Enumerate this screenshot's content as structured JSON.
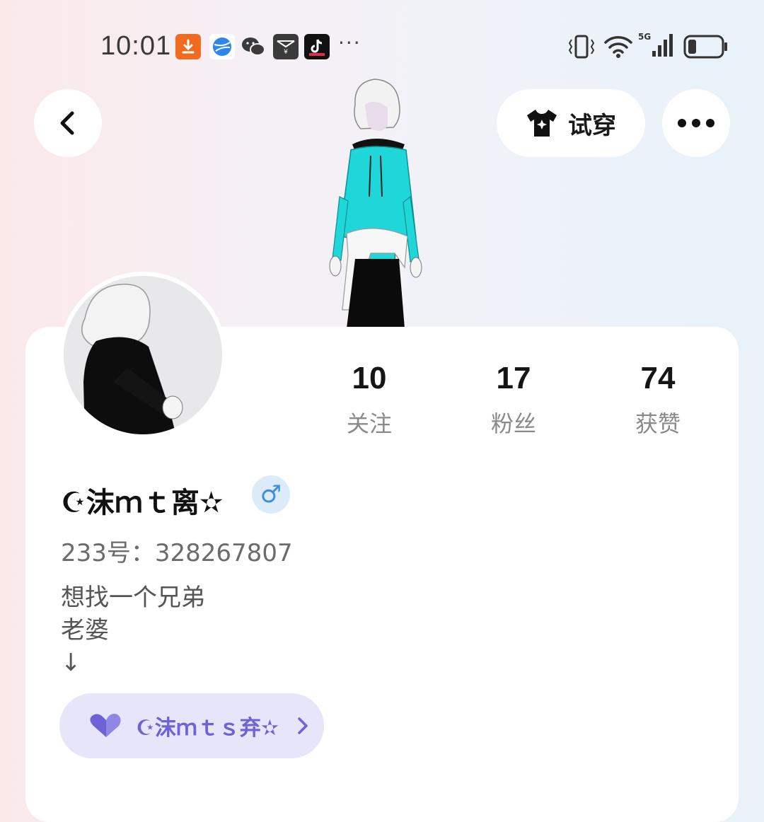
{
  "status_bar": {
    "time": "10:01",
    "icons": [
      "download-icon",
      "browser-icon",
      "wechat-icon",
      "red-packet-icon",
      "tiktok-icon"
    ],
    "more": "···",
    "network": "5G",
    "battery_level": 0.25
  },
  "header": {
    "try_on_label": "试穿"
  },
  "profile": {
    "stats": [
      {
        "count": "10",
        "label": "关注"
      },
      {
        "count": "17",
        "label": "粉丝"
      },
      {
        "count": "74",
        "label": "获赞"
      }
    ],
    "username": "☪沫ｍｔ离✫",
    "gender_symbol": "♂",
    "uid": "233号：328267807",
    "bio_lines": [
      "想找一个兄弟",
      "老婆",
      "↓"
    ],
    "group": {
      "name": "☪沫ｍｔｓ弃✫"
    }
  },
  "colors": {
    "accent_purple": "#6d63d6",
    "pill_bg": "#e6e5fa",
    "gender_blue": "#3d8de0",
    "hoodie_cyan": "#1fd6d8"
  }
}
